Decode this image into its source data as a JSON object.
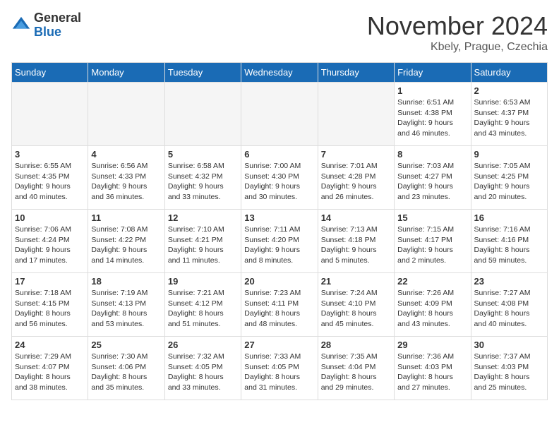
{
  "logo": {
    "general": "General",
    "blue": "Blue"
  },
  "title": "November 2024",
  "location": "Kbely, Prague, Czechia",
  "days_of_week": [
    "Sunday",
    "Monday",
    "Tuesday",
    "Wednesday",
    "Thursday",
    "Friday",
    "Saturday"
  ],
  "weeks": [
    [
      {
        "day": "",
        "info": "",
        "empty": true
      },
      {
        "day": "",
        "info": "",
        "empty": true
      },
      {
        "day": "",
        "info": "",
        "empty": true
      },
      {
        "day": "",
        "info": "",
        "empty": true
      },
      {
        "day": "",
        "info": "",
        "empty": true
      },
      {
        "day": "1",
        "info": "Sunrise: 6:51 AM\nSunset: 4:38 PM\nDaylight: 9 hours\nand 46 minutes."
      },
      {
        "day": "2",
        "info": "Sunrise: 6:53 AM\nSunset: 4:37 PM\nDaylight: 9 hours\nand 43 minutes."
      }
    ],
    [
      {
        "day": "3",
        "info": "Sunrise: 6:55 AM\nSunset: 4:35 PM\nDaylight: 9 hours\nand 40 minutes."
      },
      {
        "day": "4",
        "info": "Sunrise: 6:56 AM\nSunset: 4:33 PM\nDaylight: 9 hours\nand 36 minutes."
      },
      {
        "day": "5",
        "info": "Sunrise: 6:58 AM\nSunset: 4:32 PM\nDaylight: 9 hours\nand 33 minutes."
      },
      {
        "day": "6",
        "info": "Sunrise: 7:00 AM\nSunset: 4:30 PM\nDaylight: 9 hours\nand 30 minutes."
      },
      {
        "day": "7",
        "info": "Sunrise: 7:01 AM\nSunset: 4:28 PM\nDaylight: 9 hours\nand 26 minutes."
      },
      {
        "day": "8",
        "info": "Sunrise: 7:03 AM\nSunset: 4:27 PM\nDaylight: 9 hours\nand 23 minutes."
      },
      {
        "day": "9",
        "info": "Sunrise: 7:05 AM\nSunset: 4:25 PM\nDaylight: 9 hours\nand 20 minutes."
      }
    ],
    [
      {
        "day": "10",
        "info": "Sunrise: 7:06 AM\nSunset: 4:24 PM\nDaylight: 9 hours\nand 17 minutes."
      },
      {
        "day": "11",
        "info": "Sunrise: 7:08 AM\nSunset: 4:22 PM\nDaylight: 9 hours\nand 14 minutes."
      },
      {
        "day": "12",
        "info": "Sunrise: 7:10 AM\nSunset: 4:21 PM\nDaylight: 9 hours\nand 11 minutes."
      },
      {
        "day": "13",
        "info": "Sunrise: 7:11 AM\nSunset: 4:20 PM\nDaylight: 9 hours\nand 8 minutes."
      },
      {
        "day": "14",
        "info": "Sunrise: 7:13 AM\nSunset: 4:18 PM\nDaylight: 9 hours\nand 5 minutes."
      },
      {
        "day": "15",
        "info": "Sunrise: 7:15 AM\nSunset: 4:17 PM\nDaylight: 9 hours\nand 2 minutes."
      },
      {
        "day": "16",
        "info": "Sunrise: 7:16 AM\nSunset: 4:16 PM\nDaylight: 8 hours\nand 59 minutes."
      }
    ],
    [
      {
        "day": "17",
        "info": "Sunrise: 7:18 AM\nSunset: 4:15 PM\nDaylight: 8 hours\nand 56 minutes."
      },
      {
        "day": "18",
        "info": "Sunrise: 7:19 AM\nSunset: 4:13 PM\nDaylight: 8 hours\nand 53 minutes."
      },
      {
        "day": "19",
        "info": "Sunrise: 7:21 AM\nSunset: 4:12 PM\nDaylight: 8 hours\nand 51 minutes."
      },
      {
        "day": "20",
        "info": "Sunrise: 7:23 AM\nSunset: 4:11 PM\nDaylight: 8 hours\nand 48 minutes."
      },
      {
        "day": "21",
        "info": "Sunrise: 7:24 AM\nSunset: 4:10 PM\nDaylight: 8 hours\nand 45 minutes."
      },
      {
        "day": "22",
        "info": "Sunrise: 7:26 AM\nSunset: 4:09 PM\nDaylight: 8 hours\nand 43 minutes."
      },
      {
        "day": "23",
        "info": "Sunrise: 7:27 AM\nSunset: 4:08 PM\nDaylight: 8 hours\nand 40 minutes."
      }
    ],
    [
      {
        "day": "24",
        "info": "Sunrise: 7:29 AM\nSunset: 4:07 PM\nDaylight: 8 hours\nand 38 minutes."
      },
      {
        "day": "25",
        "info": "Sunrise: 7:30 AM\nSunset: 4:06 PM\nDaylight: 8 hours\nand 35 minutes."
      },
      {
        "day": "26",
        "info": "Sunrise: 7:32 AM\nSunset: 4:05 PM\nDaylight: 8 hours\nand 33 minutes."
      },
      {
        "day": "27",
        "info": "Sunrise: 7:33 AM\nSunset: 4:05 PM\nDaylight: 8 hours\nand 31 minutes."
      },
      {
        "day": "28",
        "info": "Sunrise: 7:35 AM\nSunset: 4:04 PM\nDaylight: 8 hours\nand 29 minutes."
      },
      {
        "day": "29",
        "info": "Sunrise: 7:36 AM\nSunset: 4:03 PM\nDaylight: 8 hours\nand 27 minutes."
      },
      {
        "day": "30",
        "info": "Sunrise: 7:37 AM\nSunset: 4:03 PM\nDaylight: 8 hours\nand 25 minutes."
      }
    ]
  ]
}
